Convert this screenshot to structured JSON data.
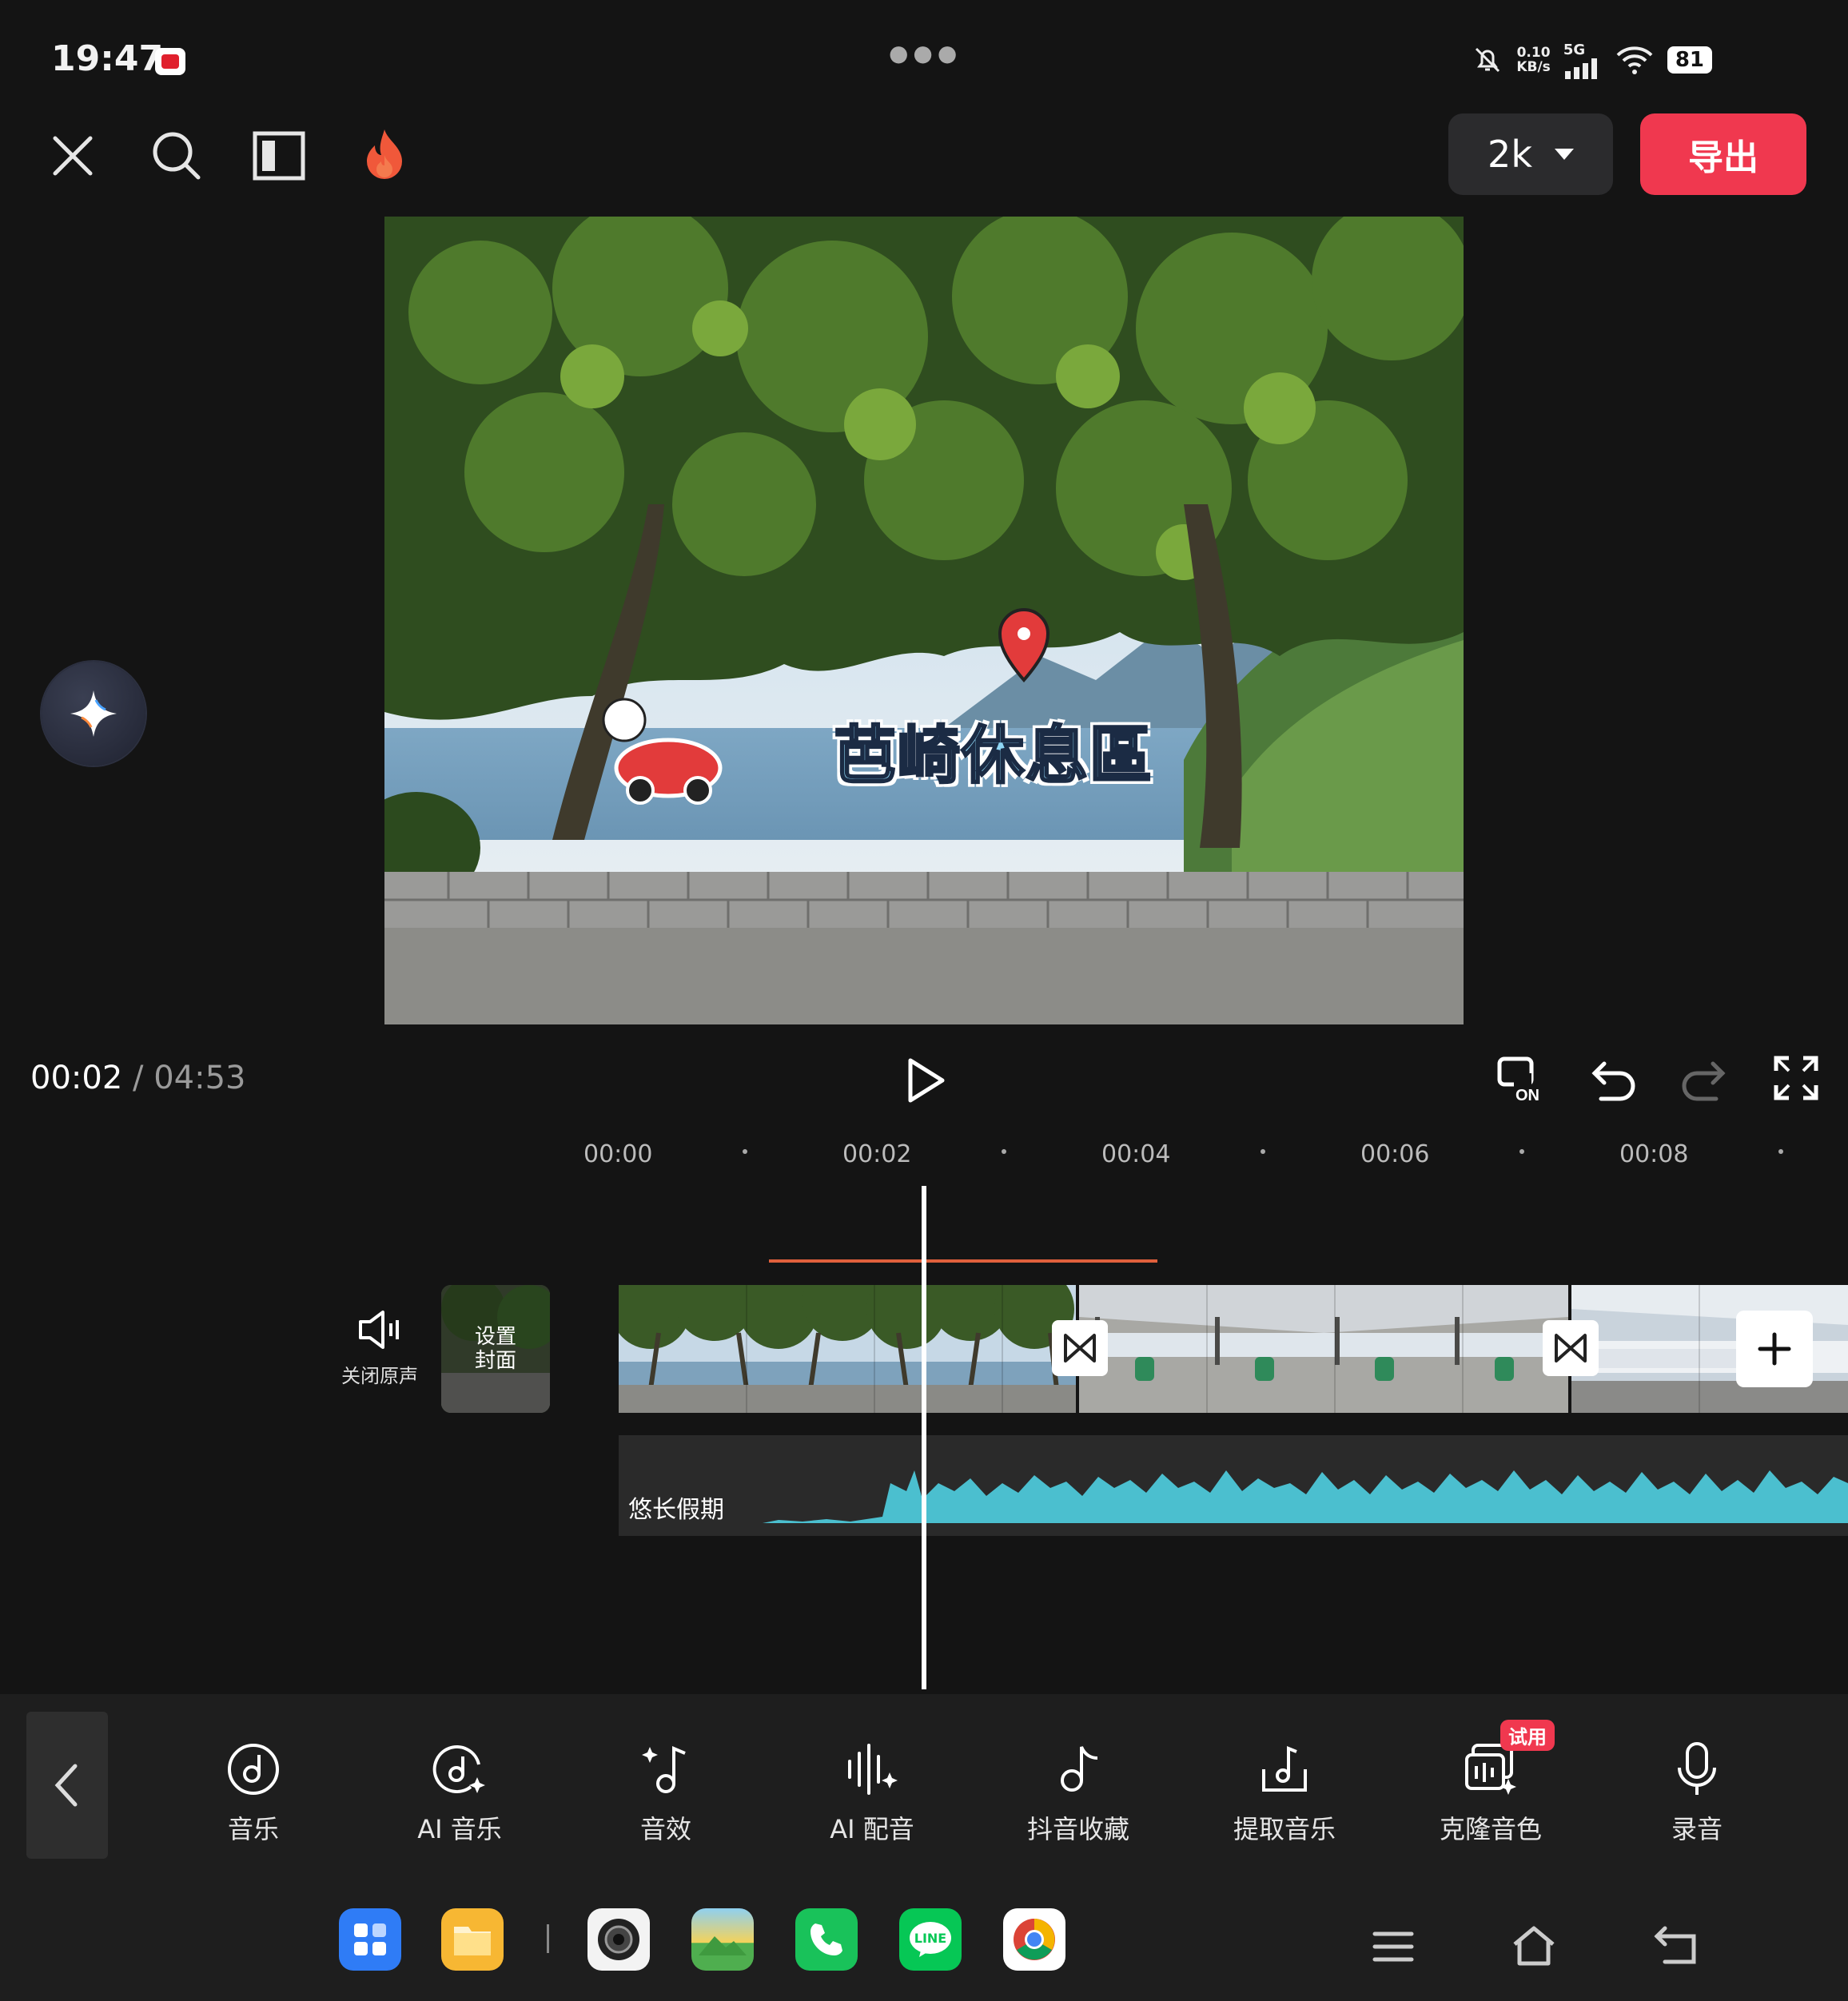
{
  "status_bar": {
    "time": "19:47",
    "net_speed_value": "0.10",
    "net_speed_unit": "KB/s",
    "network": "5G",
    "battery": "81"
  },
  "toolbar": {
    "resolution": "2k",
    "export_label": "导出"
  },
  "preview": {
    "overlay_title": "芭崎休息區"
  },
  "playback": {
    "current_time": "00:02",
    "separator": "/",
    "total_time": "04:53"
  },
  "ruler": {
    "ticks": [
      "00:00",
      "00:02",
      "00:04",
      "00:06",
      "00:08"
    ]
  },
  "track_controls": {
    "mute_label": "关闭原声",
    "cover_label_line1": "设置",
    "cover_label_line2": "封面"
  },
  "audio_track": {
    "name": "悠长假期"
  },
  "bottom_tools": [
    {
      "label": "音乐",
      "icon": "music-disc-icon"
    },
    {
      "label": "AI 音乐",
      "icon": "ai-music-icon"
    },
    {
      "label": "音效",
      "icon": "sound-effect-icon"
    },
    {
      "label": "AI 配音",
      "icon": "ai-voice-icon"
    },
    {
      "label": "抖音收藏",
      "icon": "douyin-favorite-icon"
    },
    {
      "label": "提取音乐",
      "icon": "extract-music-icon"
    },
    {
      "label": "克隆音色",
      "icon": "clone-voice-icon",
      "badge": "试用"
    },
    {
      "label": "录音",
      "icon": "microphone-icon"
    }
  ],
  "dock": {
    "apps": [
      "app-drawer",
      "files",
      "camera",
      "gallery",
      "phone",
      "line",
      "chrome"
    ],
    "line_label": "LINE"
  },
  "colors": {
    "accent_red": "#f0384f",
    "waveform": "#4bbfcf",
    "selection_line": "#e0603c"
  }
}
